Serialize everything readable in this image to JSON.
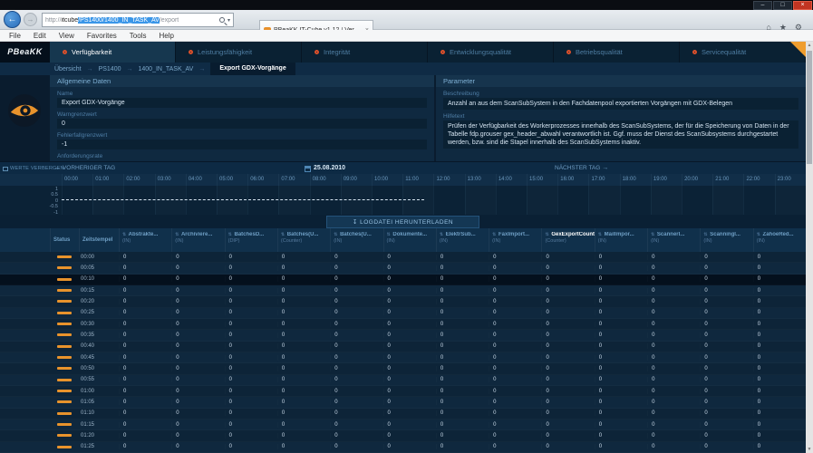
{
  "window": {
    "controls": {
      "minimize": "–",
      "maximize": "□",
      "close": "×"
    }
  },
  "browser": {
    "url_segments": [
      {
        "text": "http://",
        "style": "dim"
      },
      {
        "text": "itcube",
        "style": "normal"
      },
      {
        "text": "/PS1400/1400_IN_TASK_AV",
        "style": "selected"
      },
      {
        "text": "/export",
        "style": "dim"
      }
    ],
    "tab_title": "PBeaKK IT-Cube v1.12 / Ver...",
    "menus": [
      "File",
      "Edit",
      "View",
      "Favorites",
      "Tools",
      "Help"
    ]
  },
  "app": {
    "logo": "PBeaKK",
    "accent_color": "#e8932c",
    "nav_tabs": [
      {
        "label": "Verfügbarkeit",
        "active": true
      },
      {
        "label": "Leistungsfähigkeit",
        "active": false
      },
      {
        "label": "Integrität",
        "active": false
      },
      {
        "label": "Entwicklungsqualität",
        "active": false
      },
      {
        "label": "Betriebsqualität",
        "active": false
      },
      {
        "label": "Servicequalität",
        "active": false
      }
    ],
    "breadcrumb": [
      "Übersicht",
      "PS1400",
      "1400_IN_TASK_AV",
      "Export GDX-Vorgänge"
    ],
    "general": {
      "title": "Allgemeine Daten",
      "fields": [
        {
          "label": "Name",
          "value": "Export GDX-Vorgänge"
        },
        {
          "label": "Warngrenzwert",
          "value": "0"
        },
        {
          "label": "Fehlerfallgrenzwert",
          "value": "-1"
        },
        {
          "label": "Anforderungsrate",
          "value": null
        }
      ]
    },
    "parameter": {
      "title": "Parameter",
      "fields": [
        {
          "label": "Beschreibung",
          "value": "Anzahl an aus dem ScanSubSystem in den Fachdatenpool exportierten Vorgängen mit GDX-Belegen"
        },
        {
          "label": "Hilfetext",
          "value": "Prüfen der Verfügbarkeit des Workerprozesses innerhalb des ScanSubSystems, der für die Speicherung von Daten in der Tabelle fdp.grouser gex_header_abwahl verantwortlich ist. Ggf. muss der Dienst des ScanSubsystems durchgestartet werden, bzw. sind die Stapel innerhalb des ScanSubSystems inaktiv."
        }
      ]
    },
    "timeline": {
      "hide_values": "WERTE VERBERGEN",
      "prev_day": "VORHERIGER TAG",
      "date": "25.08.2010",
      "next_day": "NÄCHSTER TAG",
      "hours": [
        "00:00",
        "01:00",
        "02:00",
        "03:00",
        "04:00",
        "05:00",
        "06:00",
        "07:00",
        "08:00",
        "09:00",
        "10:00",
        "11:00",
        "12:00",
        "13:00",
        "14:00",
        "15:00",
        "16:00",
        "17:00",
        "18:00",
        "19:00",
        "20:00",
        "21:00",
        "22:00",
        "23:00"
      ],
      "y_ticks": [
        "1",
        "0.5",
        "0",
        "-0.5",
        "-1"
      ]
    },
    "download_button": "LOGDATEI HERUNTERLADEN",
    "table": {
      "status_header": "Status",
      "time_header": "Zeitstempel",
      "columns": [
        {
          "label": "Abstrakte...",
          "unit": "(IN)",
          "highlight": false
        },
        {
          "label": "Archiviere...",
          "unit": "(IN)",
          "highlight": false
        },
        {
          "label": "BatchesD...",
          "unit": "(DIP)",
          "highlight": false
        },
        {
          "label": "Batches(U...",
          "unit": "(Counter)",
          "highlight": false
        },
        {
          "label": "Batches(U...",
          "unit": "(IN)",
          "highlight": false
        },
        {
          "label": "Dokumente...",
          "unit": "(IN)",
          "highlight": false
        },
        {
          "label": "ElektrSub...",
          "unit": "(IN)",
          "highlight": false
        },
        {
          "label": "FaxImport...",
          "unit": "(IN)",
          "highlight": false
        },
        {
          "label": "GexExportCount",
          "unit": "(Counter)",
          "highlight": true
        },
        {
          "label": "MailImpor...",
          "unit": "(IN)",
          "highlight": false
        },
        {
          "label": "ScannerI...",
          "unit": "(IN)",
          "highlight": false
        },
        {
          "label": "ScanningI...",
          "unit": "(IN)",
          "highlight": false
        },
        {
          "label": "ZahoeRed...",
          "unit": "(IN)",
          "highlight": false
        }
      ],
      "rows": [
        {
          "time": "00:00",
          "selected": false,
          "values": [
            "0",
            "0",
            "0",
            "0",
            "0",
            "0",
            "0",
            "0",
            "0",
            "0",
            "0",
            "0",
            "0"
          ]
        },
        {
          "time": "00:05",
          "selected": false,
          "values": [
            "0",
            "0",
            "0",
            "0",
            "0",
            "0",
            "0",
            "0",
            "0",
            "0",
            "0",
            "0",
            "0"
          ]
        },
        {
          "time": "00:10",
          "selected": true,
          "values": [
            "0",
            "0",
            "0",
            "0",
            "0",
            "0",
            "0",
            "0",
            "0",
            "0",
            "0",
            "0",
            "0"
          ]
        },
        {
          "time": "00:15",
          "selected": false,
          "values": [
            "0",
            "0",
            "0",
            "0",
            "0",
            "0",
            "0",
            "0",
            "0",
            "0",
            "0",
            "0",
            "0"
          ]
        },
        {
          "time": "00:20",
          "selected": false,
          "values": [
            "0",
            "0",
            "0",
            "0",
            "0",
            "0",
            "0",
            "0",
            "0",
            "0",
            "0",
            "0",
            "0"
          ]
        },
        {
          "time": "00:25",
          "selected": false,
          "values": [
            "0",
            "0",
            "0",
            "0",
            "0",
            "0",
            "0",
            "0",
            "0",
            "0",
            "0",
            "0",
            "0"
          ]
        },
        {
          "time": "00:30",
          "selected": false,
          "values": [
            "0",
            "0",
            "0",
            "0",
            "0",
            "0",
            "0",
            "0",
            "0",
            "0",
            "0",
            "0",
            "0"
          ]
        },
        {
          "time": "00:35",
          "selected": false,
          "values": [
            "0",
            "0",
            "0",
            "0",
            "0",
            "0",
            "0",
            "0",
            "0",
            "0",
            "0",
            "0",
            "0"
          ]
        },
        {
          "time": "00:40",
          "selected": false,
          "values": [
            "0",
            "0",
            "0",
            "0",
            "0",
            "0",
            "0",
            "0",
            "0",
            "0",
            "0",
            "0",
            "0"
          ]
        },
        {
          "time": "00:45",
          "selected": false,
          "values": [
            "0",
            "0",
            "0",
            "0",
            "0",
            "0",
            "0",
            "0",
            "0",
            "0",
            "0",
            "0",
            "0"
          ]
        },
        {
          "time": "00:50",
          "selected": false,
          "values": [
            "0",
            "0",
            "0",
            "0",
            "0",
            "0",
            "0",
            "0",
            "0",
            "0",
            "0",
            "0",
            "0"
          ]
        },
        {
          "time": "00:55",
          "selected": false,
          "values": [
            "0",
            "0",
            "0",
            "0",
            "0",
            "0",
            "0",
            "0",
            "0",
            "0",
            "0",
            "0",
            "0"
          ]
        },
        {
          "time": "01:00",
          "selected": false,
          "values": [
            "0",
            "0",
            "0",
            "0",
            "0",
            "0",
            "0",
            "0",
            "0",
            "0",
            "0",
            "0",
            "0"
          ]
        },
        {
          "time": "01:05",
          "selected": false,
          "values": [
            "0",
            "0",
            "0",
            "0",
            "0",
            "0",
            "0",
            "0",
            "0",
            "0",
            "0",
            "0",
            "0"
          ]
        },
        {
          "time": "01:10",
          "selected": false,
          "values": [
            "0",
            "0",
            "0",
            "0",
            "0",
            "0",
            "0",
            "0",
            "0",
            "0",
            "0",
            "0",
            "0"
          ]
        },
        {
          "time": "01:15",
          "selected": false,
          "values": [
            "0",
            "0",
            "0",
            "0",
            "0",
            "0",
            "0",
            "0",
            "0",
            "0",
            "0",
            "0",
            "0"
          ]
        },
        {
          "time": "01:20",
          "selected": false,
          "values": [
            "0",
            "0",
            "0",
            "0",
            "0",
            "0",
            "0",
            "0",
            "0",
            "0",
            "0",
            "0",
            "0"
          ]
        },
        {
          "time": "01:25",
          "selected": false,
          "values": [
            "0",
            "0",
            "0",
            "0",
            "0",
            "0",
            "0",
            "0",
            "0",
            "0",
            "0",
            "0",
            "0"
          ]
        }
      ]
    }
  }
}
